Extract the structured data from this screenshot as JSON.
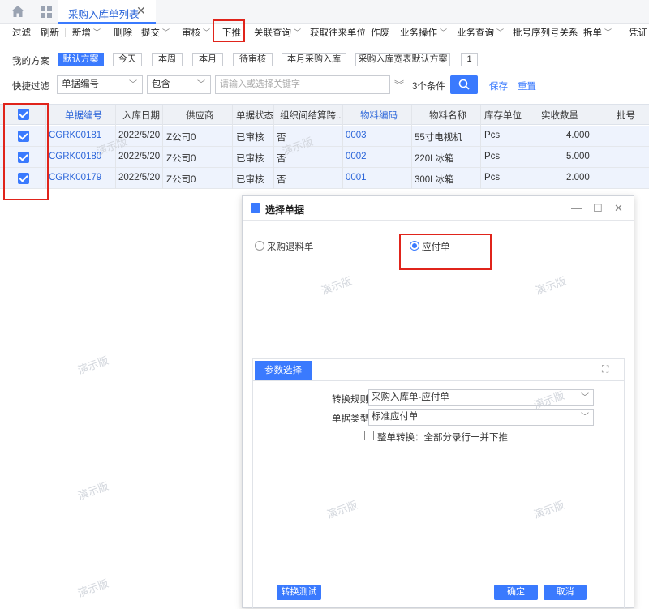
{
  "tabbar": {
    "active_tab": "采购入库单列表",
    "close": "✕"
  },
  "toolbar": {
    "items": [
      "过滤",
      "刷新",
      "新增",
      "删除",
      "提交",
      "审核",
      "下推",
      "关联查询",
      "获取往来单位",
      "作废",
      "业务操作",
      "业务查询",
      "批号序列号关系",
      "拆单",
      "凭证"
    ]
  },
  "filter": {
    "my_scheme_label": "我的方案",
    "schemes": [
      "默认方案",
      "今天",
      "本周",
      "本月",
      "待审核",
      "本月采购入库",
      "采购入库宽表默认方案",
      "1"
    ],
    "quick_filter_label": "快捷过滤",
    "field_value": "单据编号",
    "op_value": "包含",
    "keyword_placeholder": "请输入或选择关键字",
    "condition_count": "3个条件",
    "save_label": "保存",
    "reset_label": "重置"
  },
  "table": {
    "headers": [
      "单据编号",
      "入库日期",
      "供应商",
      "单据状态",
      "组织间结算跨...",
      "物料编码",
      "物料名称",
      "库存单位",
      "实收数量",
      "批号"
    ],
    "rows": [
      [
        "CGRK00181",
        "2022/5/20",
        "Z公司0",
        "已审核",
        "否",
        "0003",
        "55寸电视机",
        "Pcs",
        "4.000",
        ""
      ],
      [
        "CGRK00180",
        "2022/5/20",
        "Z公司0",
        "已审核",
        "否",
        "0002",
        "220L冰箱",
        "Pcs",
        "5.000",
        ""
      ],
      [
        "CGRK00179",
        "2022/5/20",
        "Z公司0",
        "已审核",
        "否",
        "0001",
        "300L冰箱",
        "Pcs",
        "2.000",
        ""
      ]
    ]
  },
  "dialog": {
    "title": "选择单据",
    "option_a": "采购退料单",
    "option_b": "应付单",
    "params_tab": "参数选择",
    "rule_label": "转换规则",
    "rule_value": "采购入库单-应付单",
    "type_label": "单据类型",
    "type_value": "标准应付单",
    "whole_label": "整单转换：全部分录行一并下推",
    "test_btn": "转换测试",
    "ok_btn": "确定",
    "cancel_btn": "取消"
  },
  "watermark": "演示版",
  "colors": {
    "accent": "#3a7afe",
    "highlight": "#e0241b"
  }
}
